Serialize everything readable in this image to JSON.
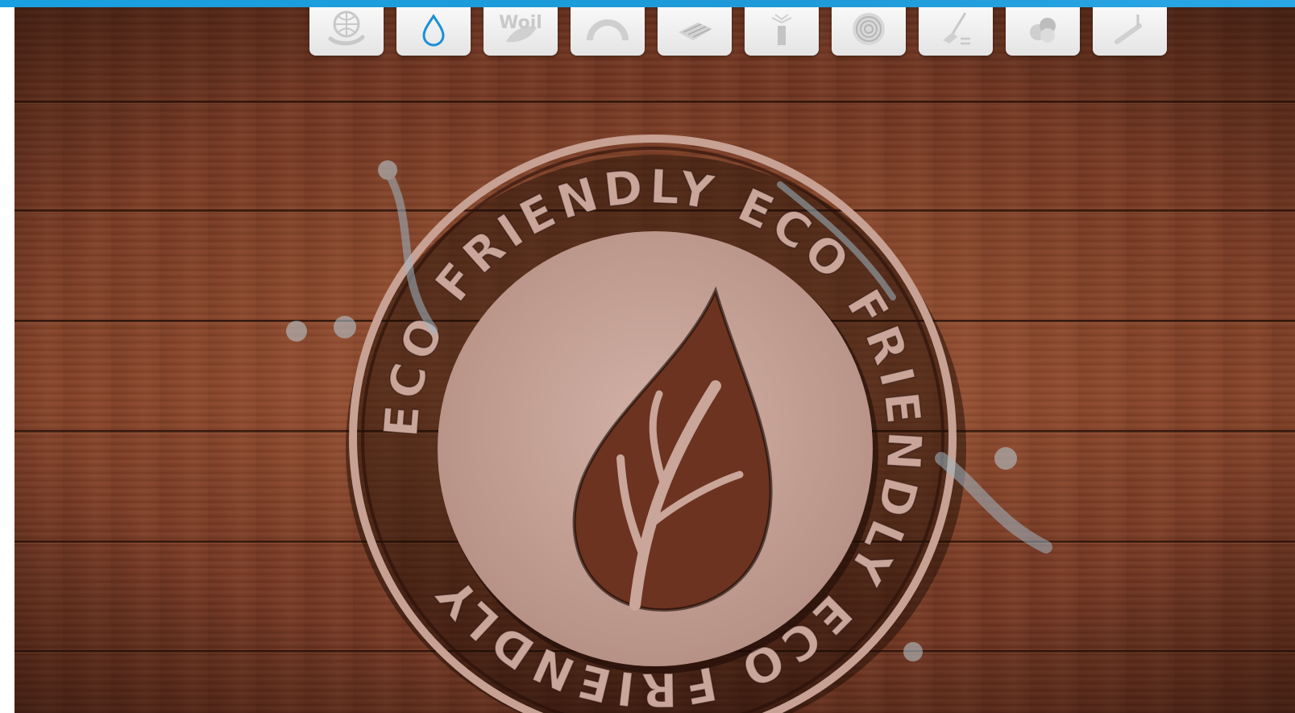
{
  "colors": {
    "accent_bar": "#1e9ad8",
    "wood_dark": "#6b3320",
    "wood_light": "#85432a",
    "seal": "#c9a59a",
    "drop_icon": "#1a90d6"
  },
  "icon_bar": [
    {
      "icon": "globe-hand-icon"
    },
    {
      "icon": "water-drop-icon"
    },
    {
      "icon": "woil-leaf-icon",
      "label": "Woil"
    },
    {
      "icon": "arch-icon"
    },
    {
      "icon": "flooring-boards-icon"
    },
    {
      "icon": "spray-can-icon"
    },
    {
      "icon": "wood-rings-icon"
    },
    {
      "icon": "mop-icon"
    },
    {
      "icon": "color-circles-icon"
    },
    {
      "icon": "paint-roller-icon"
    }
  ],
  "seal": {
    "ring_text": "ECO FRIENDLY ECO FRIENDLY ECO FRIENDLY ",
    "emblem": "leaf-drop-icon"
  }
}
